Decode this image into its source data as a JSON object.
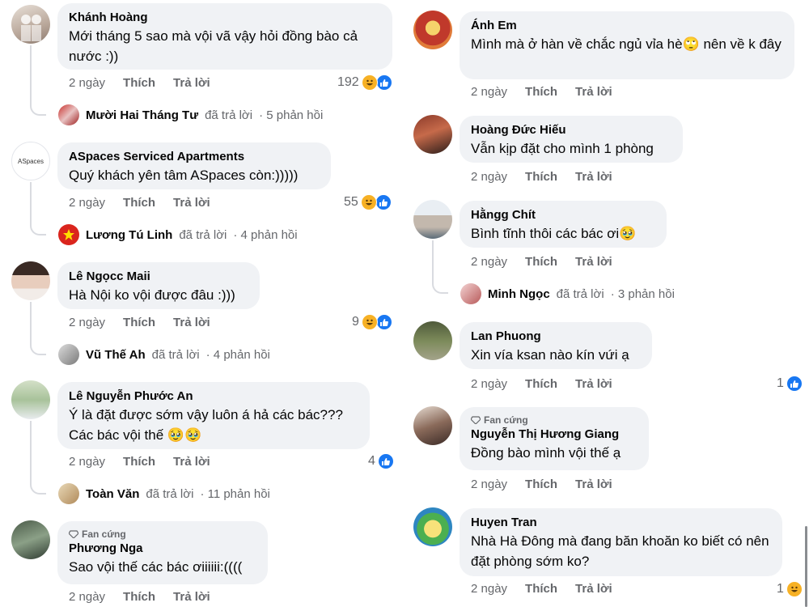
{
  "labels": {
    "like": "Thích",
    "reply": "Trả lời",
    "fan_badge": "Fan cứng"
  },
  "left_comments": [
    {
      "author": "Khánh Hoàng",
      "text": "Mới tháng 5 sao mà vội vã vậy hỏi đồng bào cả nước :))",
      "time": "2 ngày",
      "reactions": "192",
      "reply": {
        "name": "Mười Hai Tháng Tư",
        "action": "đã trả lời",
        "count": "· 5 phản hồi"
      }
    },
    {
      "author": "ASpaces Serviced Apartments",
      "avatar_text": "ASpaces",
      "text": "Quý khách yên tâm ASpaces còn:)))))",
      "time": "2 ngày",
      "reactions": "55",
      "reply": {
        "name": "Lương Tú Linh",
        "action": "đã trả lời",
        "count": "· 4 phản hồi"
      }
    },
    {
      "author": "Lê Ngọcc Maii",
      "text": "Hà Nội ko vội được đâu :)))",
      "time": "2 ngày",
      "reactions": "9",
      "reply": {
        "name": "Vũ Thế Ah",
        "action": "đã trả lời",
        "count": "· 4 phản hồi"
      }
    },
    {
      "author": "Lê Nguyễn Phước An",
      "text": "Ý là đặt được sớm vậy luôn á hả các bác??? Các bác vội thế 🥹🥹",
      "time": "2 ngày",
      "reactions": "4",
      "reply": {
        "name": "Toàn Văn",
        "action": "đã trả lời",
        "count": "· 11 phản hồi"
      }
    },
    {
      "author": "Phương Nga",
      "text": "Sao vội thế các bác ơiiiiii:((((",
      "time": "2 ngày"
    }
  ],
  "right_comments": [
    {
      "author": "Ánh Em",
      "text": "Mình mà ở hàn về chắc ngủ vỉa hè🙄 nên về k đây",
      "time": "2 ngày"
    },
    {
      "author": "Hoàng Đức Hiếu",
      "text": "Vẫn kịp đặt cho mình 1 phòng",
      "time": "2 ngày"
    },
    {
      "author": "Hằngg Chít",
      "text": "Bình tĩnh thôi các bác ơi🥹",
      "time": "2 ngày",
      "reply": {
        "name": "Minh Ngọc",
        "action": "đã trả lời",
        "count": "· 3 phản hồi"
      }
    },
    {
      "author": "Lan Phuong",
      "text": "Xin vía ksan nào kín vứi ạ",
      "time": "2 ngày",
      "reactions": "1"
    },
    {
      "author": "Nguyễn Thị Hương Giang",
      "text": "Đồng bào mình vội thế ạ",
      "time": "2 ngày"
    },
    {
      "author": "Huyen Tran",
      "text": "Nhà Hà Đông mà đang băn khoăn ko biết có nên đặt phòng sớm ko?",
      "time": "2 ngày",
      "reactions": "1"
    }
  ],
  "colors": {
    "bubble": "#f0f2f5",
    "meta": "#65676b",
    "like": "#1877f2",
    "haha": "#f7b125"
  }
}
